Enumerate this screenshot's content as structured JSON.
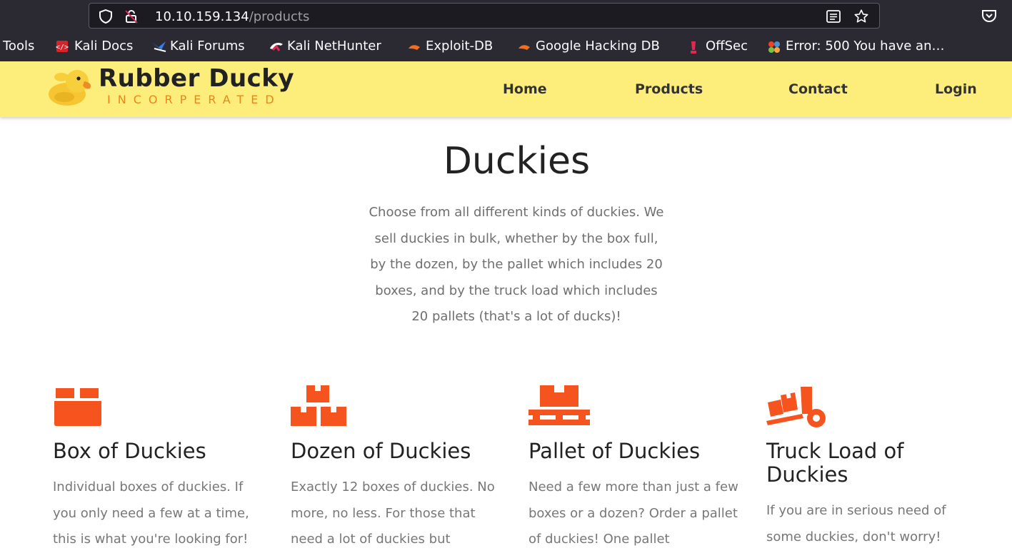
{
  "browser": {
    "url_host": "10.10.159.134",
    "url_path": "/products",
    "bookmarks": [
      {
        "label": "Tools",
        "icon": "none"
      },
      {
        "label": "Kali Docs",
        "icon": "kali-docs-icon"
      },
      {
        "label": "Kali Forums",
        "icon": "kali-forums-icon"
      },
      {
        "label": "Kali NetHunter",
        "icon": "kali-nethunter-icon"
      },
      {
        "label": "Exploit-DB",
        "icon": "exploit-db-icon"
      },
      {
        "label": "Google Hacking DB",
        "icon": "ghdb-icon"
      },
      {
        "label": "OffSec",
        "icon": "offsec-icon"
      },
      {
        "label": "Error: 500 You have an…",
        "icon": "joomla-icon"
      }
    ]
  },
  "site": {
    "brand_name": "Rubber Ducky",
    "brand_sub": "INCORPERATED",
    "nav": [
      "Home",
      "Products",
      "Contact",
      "Login"
    ]
  },
  "main": {
    "title": "Duckies",
    "intro": "Choose from all different kinds of duckies. We sell duckies in bulk, whether by the box full, by the dozen, by the pallet which includes 20 boxes, and by the truck load which includes 20 pallets (that's a lot of ducks)!",
    "products": [
      {
        "title": "Box of Duckies",
        "icon": "box-icon",
        "text": "Individual boxes of duckies. If you only need a few at a time, this is what you're looking for!"
      },
      {
        "title": "Dozen of Duckies",
        "icon": "boxes-stack-icon",
        "text": "Exactly 12 boxes of duckies. No more, no less. For those that need a lot of duckies but"
      },
      {
        "title": "Pallet of Duckies",
        "icon": "pallet-icon",
        "text": "Need a few more than just a few boxes or a dozen? Order a pallet of duckies! One pallet"
      },
      {
        "title": "Truck Load of Duckies",
        "icon": "dolly-icon",
        "text": "If you are in serious need of some duckies, don't worry!"
      }
    ]
  },
  "colors": {
    "header_bg": "#fded7b",
    "accent_orange": "#f5541f",
    "brand_sub": "#e8871e"
  }
}
